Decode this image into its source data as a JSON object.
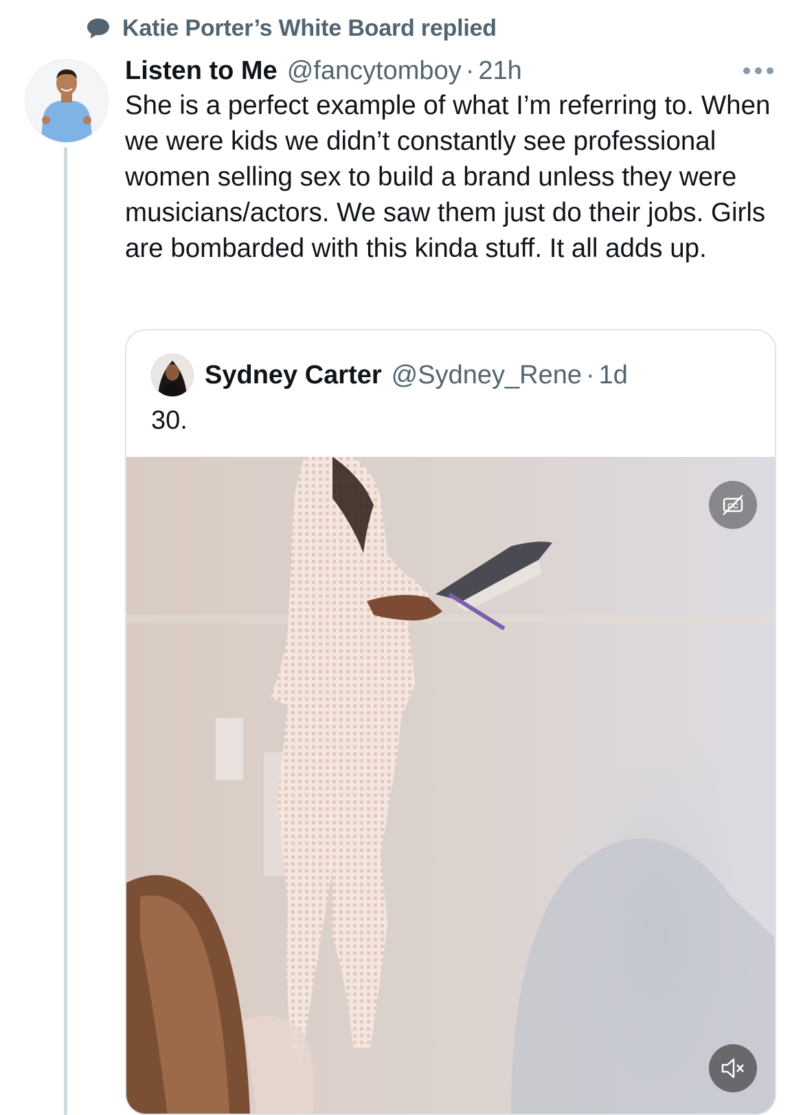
{
  "context": {
    "label": "Katie Porter’s White Board replied",
    "icon": "speech-bubble-icon"
  },
  "tweet": {
    "display_name": "Listen to Me",
    "handle": "@fancytomboy",
    "separator": "·",
    "time": "21h",
    "more_icon": "more-horizontal-icon",
    "body": "She is a perfect example of what I’m referring to. When we were kids we didn’t constantly see professional women selling sex to build a brand unless they were musicians/actors. We saw them just do their jobs. Girls are bombarded with this kinda stuff. It all adds up."
  },
  "quote": {
    "display_name": "Sydney Carter",
    "handle": "@Sydney_Rene",
    "separator": "·",
    "time": "1d",
    "text": "30.",
    "media": {
      "type": "video",
      "captions_icon": "captions-off-icon",
      "mute_icon": "volume-muted-icon"
    }
  },
  "colors": {
    "secondary_text": "#536471",
    "primary_text": "#0f1419",
    "border": "#dfe4e8",
    "thread_line": "#cfd9de"
  }
}
